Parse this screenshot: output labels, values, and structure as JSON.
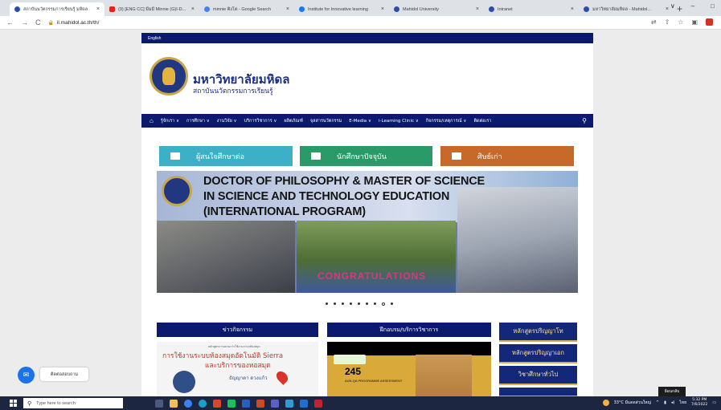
{
  "browser": {
    "tabs": [
      {
        "title": "สถาบันนวัตกรรมการเรียนรู้ มหิดล",
        "color": "#2b4ea8",
        "active": true
      },
      {
        "title": "(9) [ENG CC] มีมมี่ Minnie (G)I-D...",
        "color": "#e62117",
        "active": false
      },
      {
        "title": "minnie ติ่งโต - Google Search",
        "color": "#4285f4",
        "active": false
      },
      {
        "title": "Institute for Innovative learning",
        "color": "#1877f2",
        "active": false
      },
      {
        "title": "Mahidol University",
        "color": "#2b4ea8",
        "active": false
      },
      {
        "title": "Intranet",
        "color": "#2b4ea8",
        "active": false
      },
      {
        "title": "มหาวิทยาลัยมหิดล - Mahidol...",
        "color": "#2b4ea8",
        "active": false
      }
    ],
    "new_tab": "+",
    "url": "il.mahidol.ac.th/th/",
    "nav": {
      "back": "←",
      "forward": "→",
      "reload": "C"
    }
  },
  "site": {
    "language": "English",
    "university_name": "มหาวิทยาลัยมหิดล",
    "institute_name": "สถาบันนวัตกรรมการเรียนรู้",
    "menu": [
      "รู้จักเรา ∨",
      "การศึกษา ∨",
      "งานวิจัย ∨",
      "บริการวิชาการ ∨",
      "ผลิตภัณฑ์",
      "จุลสารนวัตกรรม",
      "E-Media ∨",
      "i-Learning Clinic ∨",
      "กิจกรรม/เหตุการณ์ ∨",
      "ติดต่อเรา"
    ],
    "quick_links": [
      "ผู้สนใจศึกษาต่อ",
      "นักศึกษาปัจจุบัน",
      "ศิษย์เก่า"
    ],
    "banner": {
      "line1": "DOCTOR OF PHILOSOPHY & MASTER OF SCIENCE",
      "line2": "IN SCIENCE AND TECHNOLOGY EDUCATION",
      "line3": "(INTERNATIONAL PROGRAM)",
      "congrats": "CONGRATULATIONS"
    },
    "carousel": {
      "count": 9,
      "active": 7
    },
    "sections": {
      "activities": "ข่าวกิจกรรม",
      "training": "ฝึกอบรม/บริการวิชาการ"
    },
    "activity_card": {
      "small": "หลักสูตรการอบรมการใช้งานระบบห้องสมุด",
      "line1": "การใช้งานระบบห้องสมุดอัตโนมัติ Sierra",
      "line2": "และบริการของหอสมุด",
      "speaker": "ธัญญาดา ดวงแก้ว"
    },
    "training_card": {
      "number": "245",
      "subtitle": "AUN-QA PROGRAMME ASSESSMENT"
    },
    "side_links": [
      "หลักสูตรปริญญาโท",
      "หลักสูตรปริญญาเอก",
      "วิชาศึกษาทั่วไป",
      ""
    ]
  },
  "widgets": {
    "contact_label": "ติดต่อสอบถาม",
    "tooltip": "ย้อนกลับ"
  },
  "taskbar": {
    "search_placeholder": "Type here to search",
    "weather": "33°C มีแดดส่วนใหญ่",
    "lang": "ไทย",
    "time": "5:32 PM",
    "date": "7/6/2022"
  }
}
